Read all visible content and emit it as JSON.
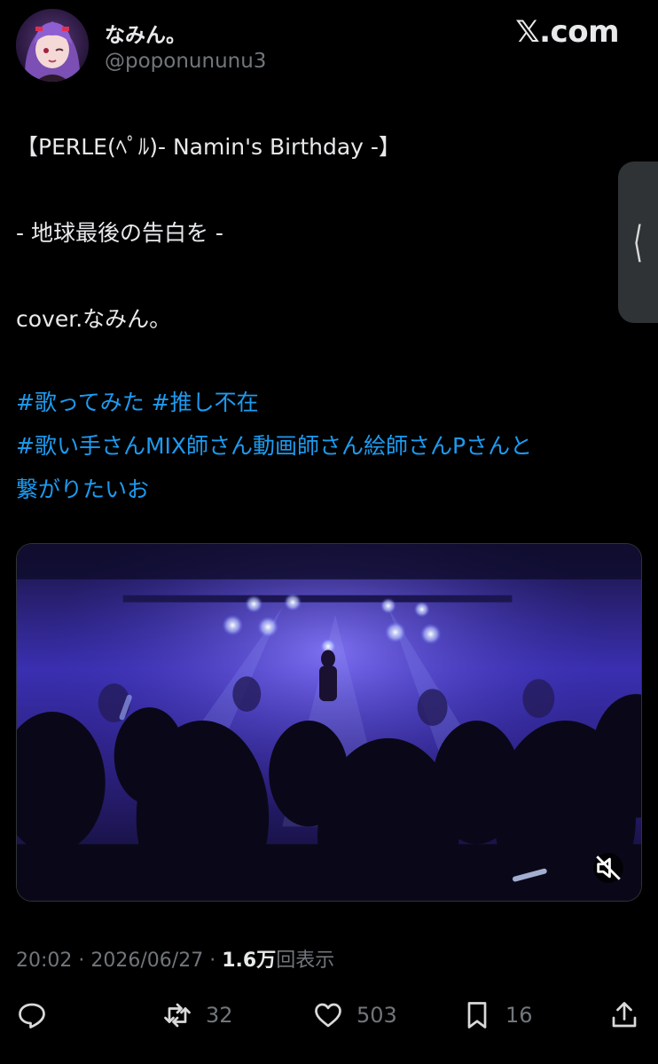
{
  "author": {
    "display_name": "なみん。",
    "handle": "@poponununu3"
  },
  "header": {
    "brand": "𝕏.com"
  },
  "tweet": {
    "line1": "【PERLE(ﾍﾟﾙ)- Namin's Birthday -】",
    "line2": "-  地球最後の告白を -",
    "line3": "cover.なみん。",
    "hashtags_line1": [
      "#歌ってみた",
      "#推し不在"
    ],
    "hashtags_line2": "#歌い手さんMIX師さん動画師さん絵師さんPさんと",
    "hashtags_line3": "繋がりたいお"
  },
  "media": {
    "icon": "mute-icon"
  },
  "meta": {
    "time": "20:02",
    "date": "2026/06/27",
    "views_count": "1.6万",
    "views_label": "回表示",
    "separator": "·"
  },
  "actions": {
    "reply": {
      "icon": "reply-icon",
      "count": ""
    },
    "retweet": {
      "icon": "retweet-icon",
      "count": "32"
    },
    "like": {
      "icon": "heart-icon",
      "count": "503"
    },
    "bookmark": {
      "icon": "bookmark-icon",
      "count": "16"
    },
    "share": {
      "icon": "share-icon",
      "count": ""
    }
  },
  "colors": {
    "background": "#000000",
    "text": "#e7e9ea",
    "muted": "#71767b",
    "link": "#1d9bf0"
  }
}
